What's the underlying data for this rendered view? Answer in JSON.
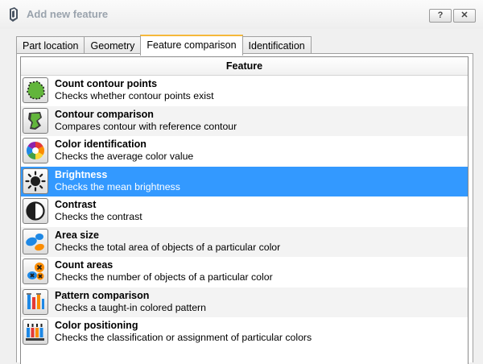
{
  "window": {
    "title": "Add new feature",
    "help_label": "?",
    "close_label": "✕"
  },
  "tabs": [
    {
      "label": "Part location",
      "active": false
    },
    {
      "label": "Geometry",
      "active": false
    },
    {
      "label": "Feature comparison",
      "active": true
    },
    {
      "label": "Identification",
      "active": false
    }
  ],
  "list": {
    "header": "Feature",
    "selected_index": 3,
    "items": [
      {
        "title": "Count contour points",
        "description": "Checks whether contour points exist",
        "icon": "contour-points-icon"
      },
      {
        "title": "Contour comparison",
        "description": "Compares contour with reference contour",
        "icon": "contour-comparison-icon"
      },
      {
        "title": "Color identification",
        "description": "Checks the average color value",
        "icon": "color-wheel-icon"
      },
      {
        "title": "Brightness",
        "description": "Checks the mean brightness",
        "icon": "sun-icon"
      },
      {
        "title": "Contrast",
        "description": "Checks the contrast",
        "icon": "contrast-icon"
      },
      {
        "title": "Area size",
        "description": "Checks the total area of objects of a particular color",
        "icon": "area-size-icon"
      },
      {
        "title": "Count areas",
        "description": "Checks the number of objects of a particular color",
        "icon": "count-areas-icon"
      },
      {
        "title": "Pattern comparison",
        "description": "Checks a taught-in colored pattern",
        "icon": "pattern-icon"
      },
      {
        "title": "Color positioning",
        "description": "Checks the classification or assignment of particular colors",
        "icon": "color-positioning-icon"
      }
    ]
  },
  "colors": {
    "selection": "#3399ff",
    "active_tab_accent": "#f5b83a",
    "title_text": "#9aa3ad"
  }
}
